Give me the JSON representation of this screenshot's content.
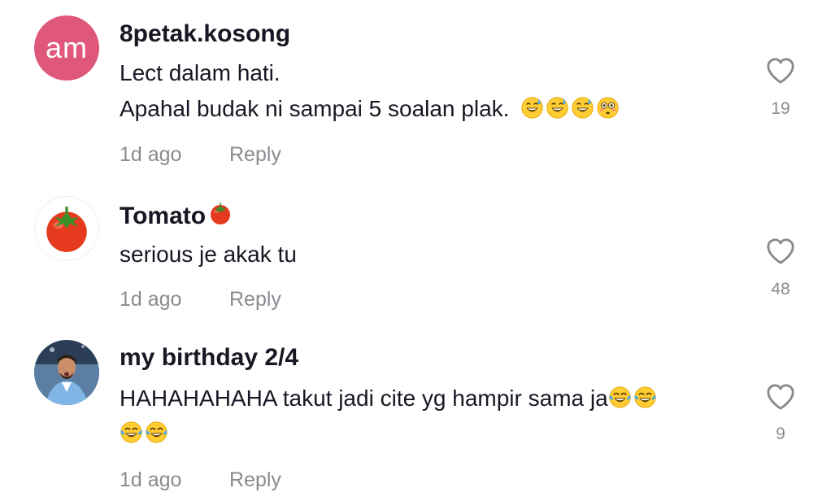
{
  "comments": [
    {
      "avatar_initials": "am",
      "avatar_color": "#e0577c",
      "username": "8petak.kosong",
      "text_lines": [
        "Lect dalam hati.",
        "Apahal budak ni sampai 5 soalan plak."
      ],
      "emojis": [
        "sweat-smile-emoji",
        "sweat-smile-emoji",
        "sweat-smile-emoji",
        "flushed-emoji"
      ],
      "time": "1d ago",
      "reply_label": "Reply",
      "likes": "19"
    },
    {
      "avatar_icon": "tomato-icon",
      "username": "Tomato",
      "username_emoji": "tomato-emoji",
      "text_lines": [
        "serious je akak tu"
      ],
      "time": "1d ago",
      "reply_label": "Reply",
      "likes": "48"
    },
    {
      "avatar_icon": "user-photo",
      "username": "my birthday 2/4",
      "text_lines": [
        "HAHAHAHAHA takut jadi cite yg hampir sama ja"
      ],
      "emojis": [
        "tears-of-joy-emoji",
        "tears-of-joy-emoji",
        "tears-of-joy-emoji",
        "tears-of-joy-emoji"
      ],
      "time": "1d ago",
      "reply_label": "Reply",
      "likes": "9"
    }
  ],
  "colors": {
    "text_primary": "#161823",
    "text_secondary": "#8a8b91",
    "heart_outline": "#8a8b91"
  }
}
